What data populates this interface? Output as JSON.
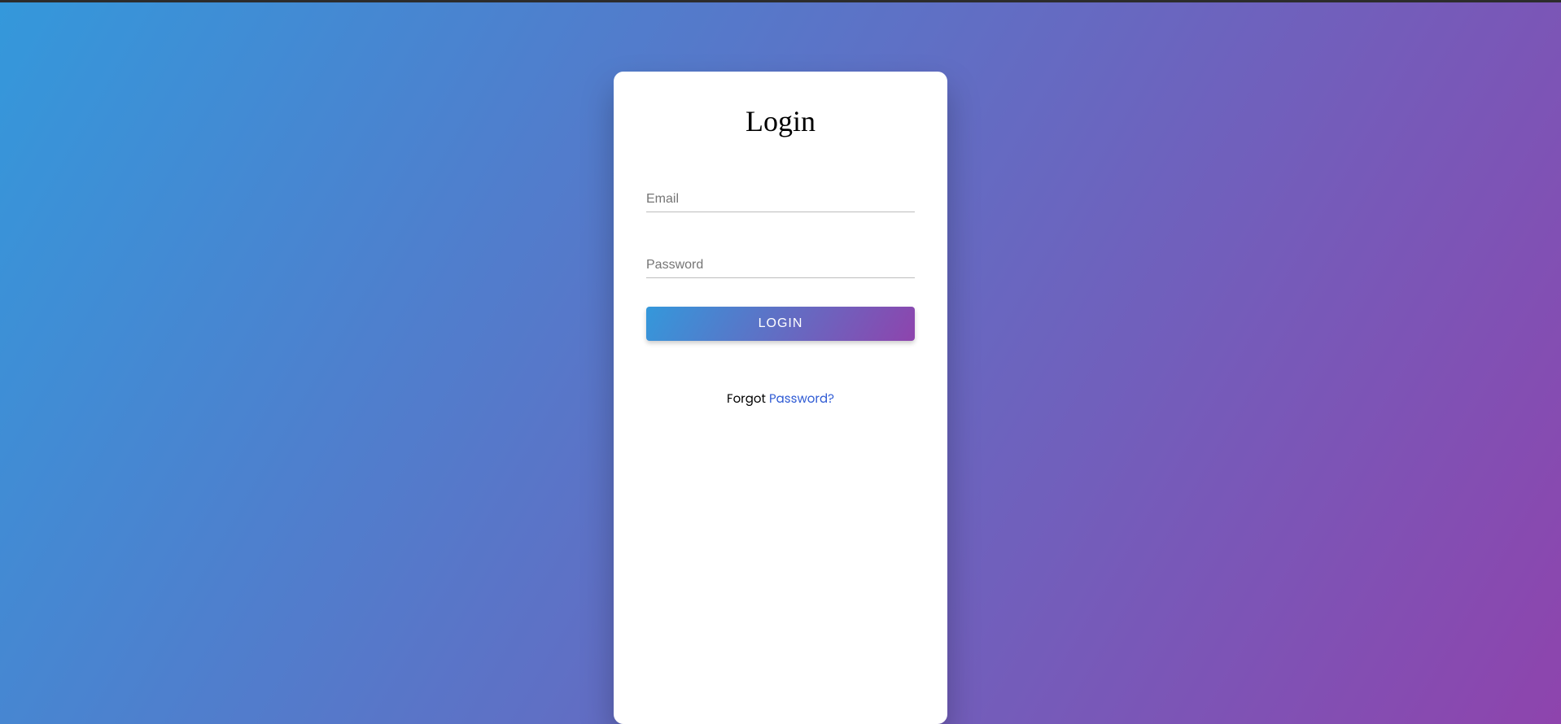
{
  "header": {
    "title": "Login"
  },
  "form": {
    "email_placeholder": "Email",
    "password_placeholder": "Password",
    "login_button_label": "LOGIN"
  },
  "footer": {
    "forgot_prefix": "Forgot ",
    "forgot_link": "Password?"
  }
}
